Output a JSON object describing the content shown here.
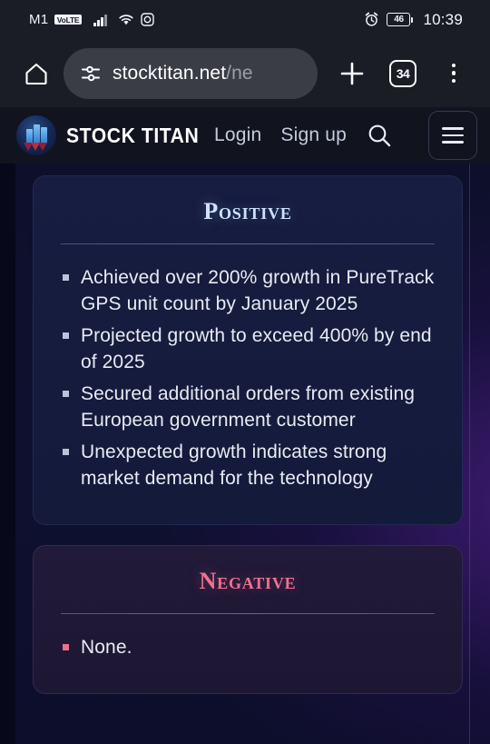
{
  "status_bar": {
    "carrier": "M1",
    "volte_badge": "VoLTE",
    "signal_icon": "signal-bars-icon",
    "wifi_icon": "wifi-icon",
    "screenshot_icon": "screen-record-icon",
    "alarm_icon": "alarm-clock-icon",
    "battery_level": "46",
    "time": "10:39"
  },
  "browser": {
    "home_icon": "home-icon",
    "page_info_icon": "tune-sliders-icon",
    "url_main": "stocktitan.net",
    "url_path": "/ne",
    "url_full": "stocktitan.net/ne",
    "new_tab_icon": "plus-icon",
    "tab_count": "34",
    "menu_icon": "three-dot-menu-icon"
  },
  "site_header": {
    "logo_icon": "stock-titan-logo-icon",
    "brand": "STOCK TITAN",
    "login_label": "Login",
    "signup_label": "Sign up",
    "search_icon": "search-icon",
    "menu_icon": "hamburger-menu-icon"
  },
  "main": {
    "positive_card": {
      "title": "Positive",
      "items": [
        "Achieved over 200% growth in PureTrack GPS unit count by January 2025",
        "Projected growth to exceed 400% by end of 2025",
        "Secured additional orders from existing European government customer",
        "Unexpected growth indicates strong market demand for the technology"
      ]
    },
    "negative_card": {
      "title": "Negative",
      "items": [
        "None."
      ]
    }
  },
  "colors": {
    "positive_accent": "#cfe1fb",
    "negative_accent": "#f2708f",
    "page_background": "#0e1030",
    "card_positive_bg": "#171d40",
    "card_negative_bg": "#211a39"
  }
}
